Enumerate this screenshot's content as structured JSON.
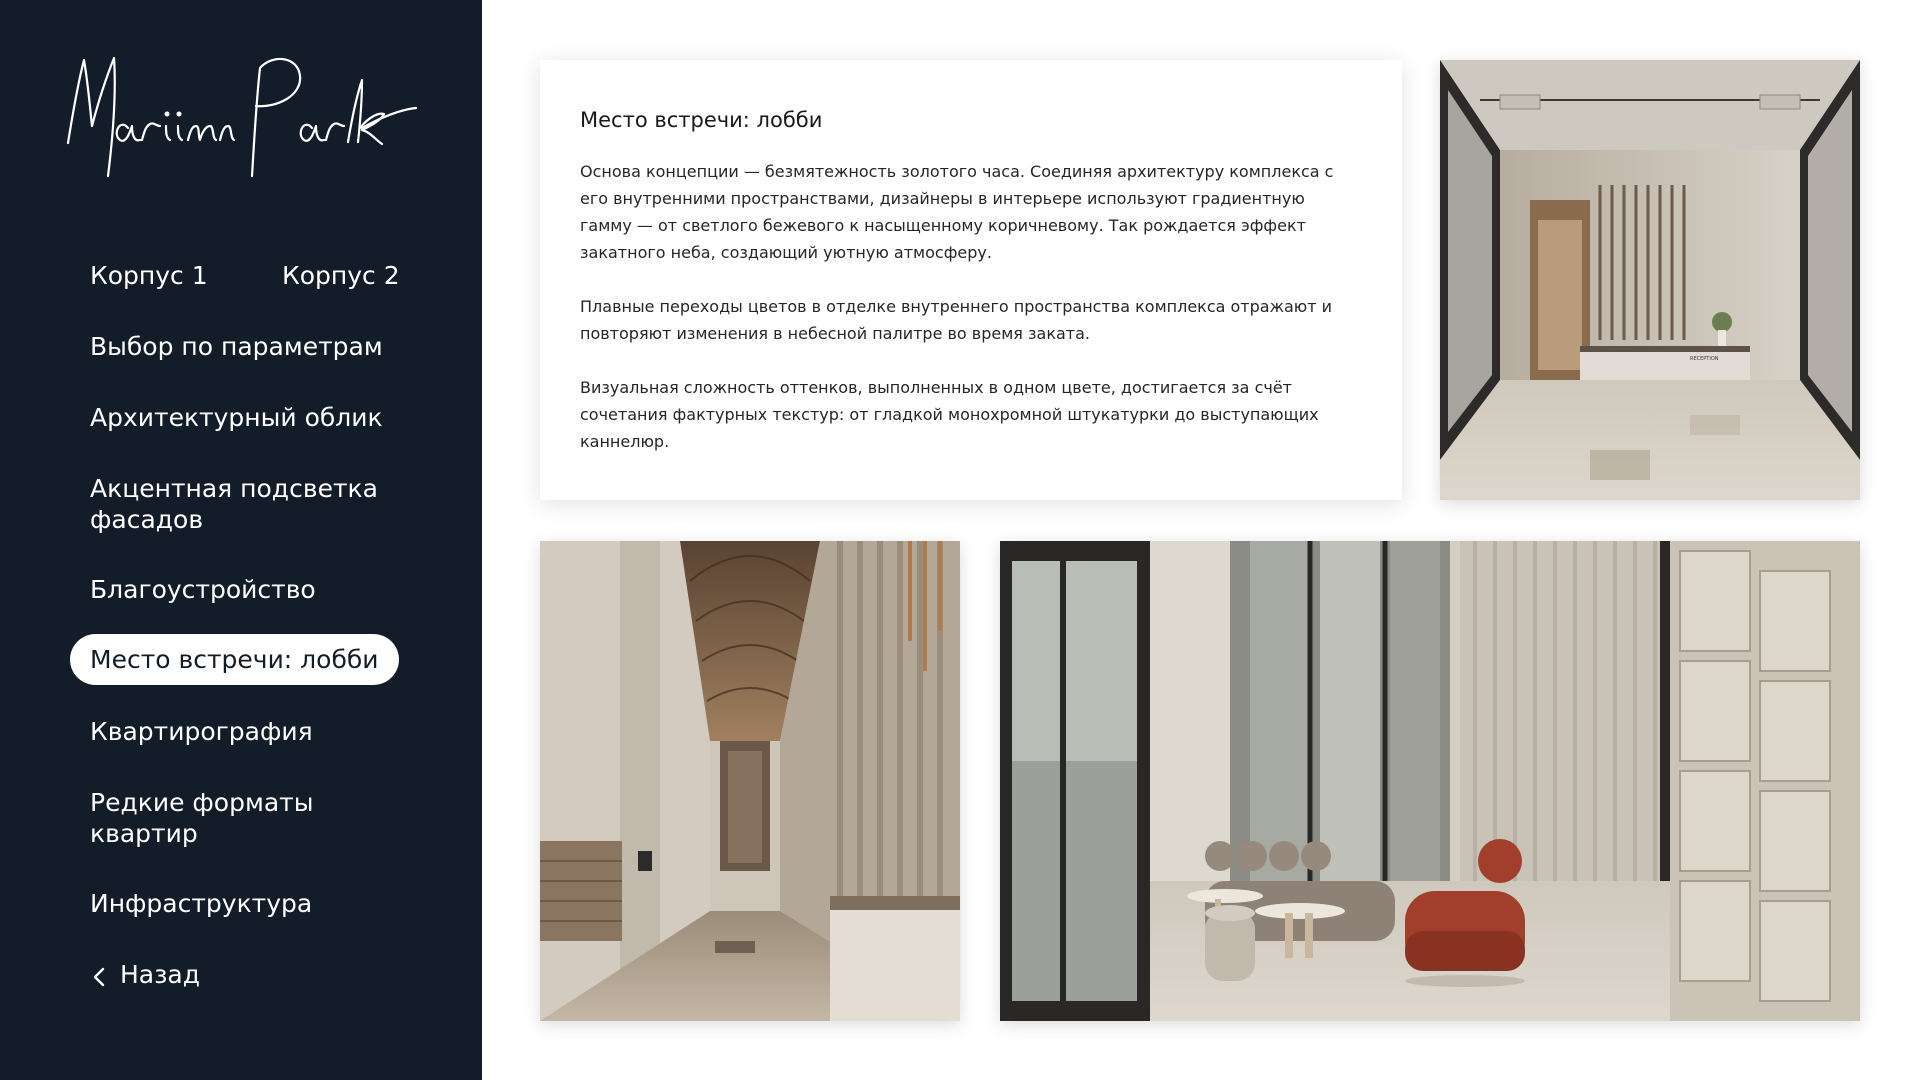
{
  "logo": {
    "text": "Mariinn Park"
  },
  "nav": {
    "korpus1": "Корпус 1",
    "korpus2": "Корпус 2",
    "items": [
      "Выбор по параметрам",
      "Архитектурный облик",
      "Акцентная подсветка фасадов",
      "Благоустройство",
      "Место встречи: лобби",
      "Квартирография",
      "Редкие форматы квартир",
      "Инфраструктура"
    ],
    "active_index": 4,
    "back": "Назад"
  },
  "card": {
    "title": "Место встречи: лобби",
    "paragraphs": [
      "Основа концепции — безмятежность золотого часа. Соединяя архитектуру комплекса с его внутренними пространствами, дизайнеры в интерьере используют градиентную гамму — от светлого бежевого к насыщенному коричневому. Так рождается эффект закатного неба, создающий уютную атмосферу.",
      "Плавные переходы цветов в отделке внутреннего пространства комплекса отражают и повторяют изменения в небесной палитре во время заката.",
      "Визуальная сложность оттенков, выполненных в одном цвете, достигается за счёт сочетания фактурных текстур: от гладкой монохромной штукатурки до выступающих каннелюр."
    ]
  },
  "photos": {
    "reception_sign": "RECEPTION"
  },
  "colors": {
    "sidebar_bg": "#131d29",
    "active_bg": "#ffffff",
    "text_light": "#ffffff",
    "text_dark": "#1a1a1a"
  },
  "icons": {
    "back": "chevron-left-icon"
  }
}
